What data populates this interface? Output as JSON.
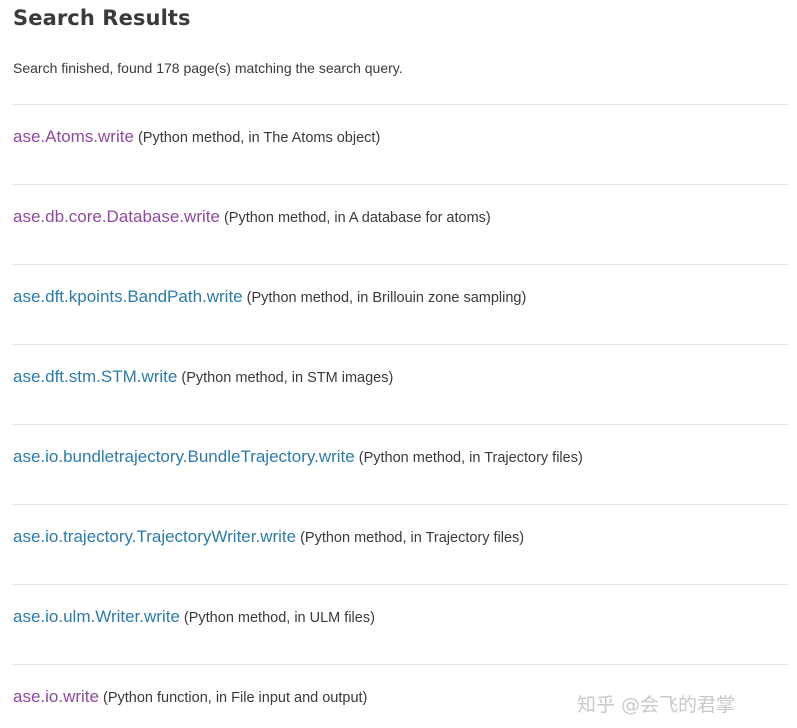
{
  "page": {
    "title": "Search Results",
    "summary": "Search finished, found 178 page(s) matching the search query."
  },
  "results": [
    {
      "link": "ase.Atoms.write",
      "context": "(Python method, in The Atoms object)",
      "visited": true
    },
    {
      "link": "ase.db.core.Database.write",
      "context": "(Python method, in A database for atoms)",
      "visited": true
    },
    {
      "link": "ase.dft.kpoints.BandPath.write",
      "context": "(Python method, in Brillouin zone sampling)",
      "visited": false
    },
    {
      "link": "ase.dft.stm.STM.write",
      "context": "(Python method, in STM images)",
      "visited": false
    },
    {
      "link": "ase.io.bundletrajectory.BundleTrajectory.write",
      "context": "(Python method, in Trajectory files)",
      "visited": false
    },
    {
      "link": "ase.io.trajectory.TrajectoryWriter.write",
      "context": "(Python method, in Trajectory files)",
      "visited": false
    },
    {
      "link": "ase.io.ulm.Writer.write",
      "context": "(Python method, in ULM files)",
      "visited": false
    },
    {
      "link": "ase.io.write",
      "context": "(Python function, in File input and output)",
      "visited": true
    }
  ],
  "watermark": "知乎 @会飞的君掌",
  "colors": {
    "visited_link": "#8e4a9c",
    "unvisited_link": "#2e7ba8",
    "text": "#3a3a3a",
    "divider": "#e4e4e4"
  }
}
